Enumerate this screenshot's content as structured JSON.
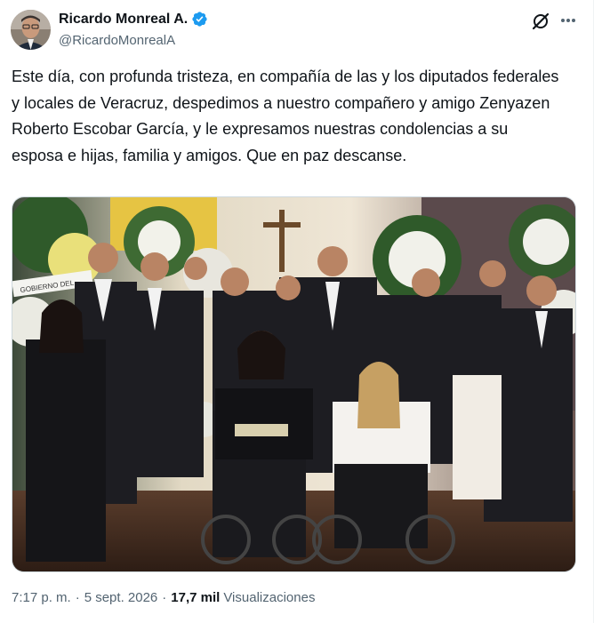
{
  "author": {
    "display_name": "Ricardo Monreal A.",
    "handle": "@RicardoMonrealA",
    "verified_icon": "verified-badge-icon",
    "avatar_icon": "avatar-photo"
  },
  "header_actions": {
    "grok_icon": "grok-slash-icon",
    "more_icon": "more-dots-icon"
  },
  "tweet": {
    "text": "Este día, con profunda tristeza, en compañía de las y los diputados federales y locales de Veracruz, despedimos a nuestro compañero y amigo Zenyazen Roberto Escobar García, y le expresamos nuestras condolencias a su esposa e hijas, familia y amigos. Que en paz descanse."
  },
  "media": {
    "wreath_banner_text": "GOBIERNO DEL"
  },
  "meta": {
    "time": "7:17 p. m.",
    "separator": "·",
    "date": "5 sept. 2026",
    "views_count": "17,7 mil",
    "views_label": "Visualizaciones"
  },
  "colors": {
    "text_primary": "#0f1419",
    "text_secondary": "#536471",
    "verified_blue": "#1d9bf0",
    "border": "#cfd9de"
  }
}
